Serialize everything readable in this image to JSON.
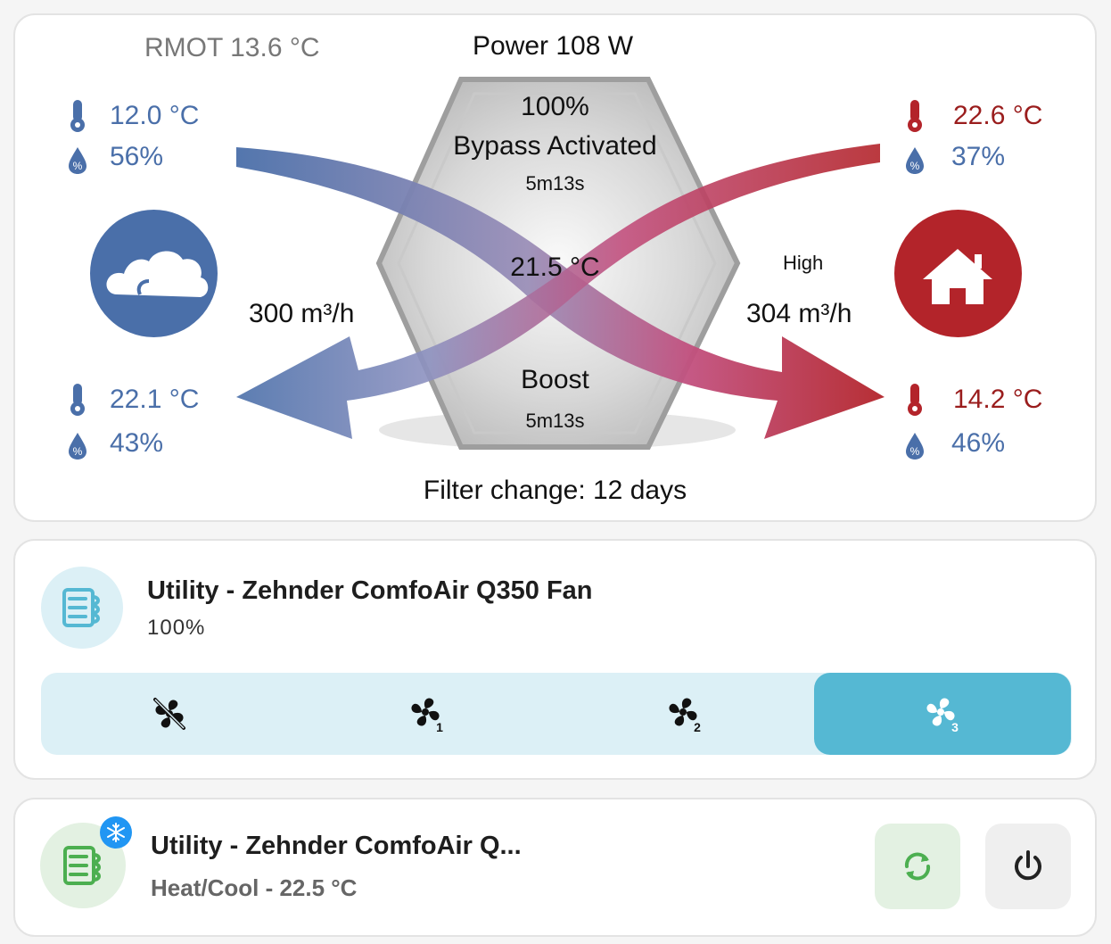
{
  "overview": {
    "rmot": "RMOT 13.6 °C",
    "power": "Power 108 W",
    "outdoor_in": {
      "temp": "12.0 °C",
      "humidity": "56%"
    },
    "outdoor_out": {
      "temp": "22.1 °C",
      "humidity": "43%"
    },
    "indoor_in": {
      "temp": "22.6 °C",
      "humidity": "37%"
    },
    "indoor_out": {
      "temp": "14.2 °C",
      "humidity": "46%"
    },
    "fan_percent": "100%",
    "bypass_label": "Bypass Activated",
    "bypass_time": "5m13s",
    "center_temp": "21.5 °C",
    "boost_label": "Boost",
    "boost_time": "5m13s",
    "airflow_left": "300 m³/h",
    "airflow_right": "304 m³/h",
    "fan_mode": "High",
    "filter": "Filter change: 12 days",
    "colors": {
      "blue": "#4a6fa9",
      "red": "#b3242a"
    }
  },
  "fan_card": {
    "title": "Utility - Zehnder ComfoAir Q350 Fan",
    "subtitle": "100%",
    "icon": "hvac-icon",
    "modes": [
      {
        "name": "fan-off-icon",
        "active": false
      },
      {
        "name": "fan-speed-1-icon",
        "active": false
      },
      {
        "name": "fan-speed-2-icon",
        "active": false
      },
      {
        "name": "fan-speed-3-icon",
        "active": true
      }
    ],
    "accent": "#55b8d3"
  },
  "climate_card": {
    "title": "Utility - Zehnder ComfoAir Q...",
    "subtitle": "Heat/Cool - 22.5 °C",
    "badge_icon": "snowflake-icon",
    "buttons": [
      {
        "name": "cycle-icon"
      },
      {
        "name": "power-icon"
      }
    ],
    "accent": "#4caf50"
  }
}
